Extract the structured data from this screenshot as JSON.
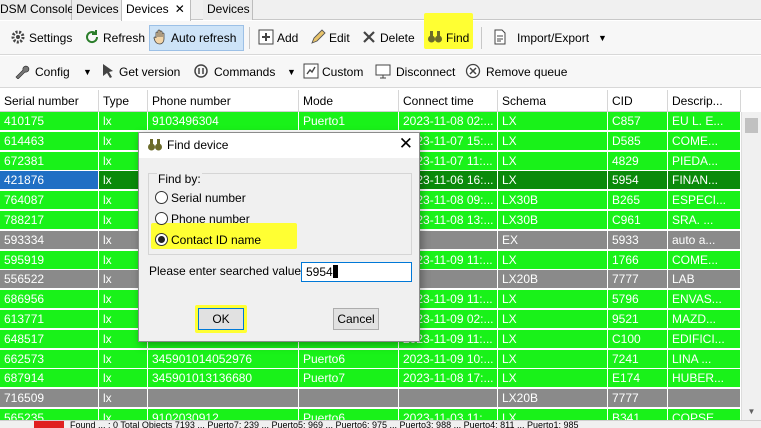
{
  "tabs": [
    {
      "label": "DSM Console",
      "active": false,
      "closable": false
    },
    {
      "label": "Devices",
      "active": false,
      "closable": false
    },
    {
      "label": "Devices",
      "active": true,
      "closable": true
    },
    {
      "label": "Devices",
      "active": false,
      "closable": false
    }
  ],
  "toolbar1": {
    "settings": "Settings",
    "refresh": "Refresh",
    "auto_refresh": "Auto refresh",
    "add": "Add",
    "edit": "Edit",
    "delete": "Delete",
    "find": "Find",
    "import_export": "Import/Export"
  },
  "toolbar2": {
    "config": "Config",
    "get_version": "Get version",
    "commands": "Commands",
    "custom": "Custom",
    "disconnect": "Disconnect",
    "remove_queue": "Remove queue"
  },
  "table": {
    "columns": [
      "Serial number",
      "Type",
      "Phone number",
      "Mode",
      "Connect time",
      "Schema",
      "CID",
      "Descrip..."
    ],
    "rows": [
      {
        "status": "online",
        "cells": [
          "410175",
          "lx",
          "9103496304",
          "Puerto1",
          "2023-11-08 02:...",
          "LX",
          "C857",
          "EU L. E..."
        ]
      },
      {
        "status": "online",
        "cells": [
          "614463",
          "lx",
          "",
          "",
          "2023-11-07 15:...",
          "LX",
          "D585",
          "COME..."
        ]
      },
      {
        "status": "online",
        "cells": [
          "672381",
          "lx",
          "",
          "",
          "2023-11-07 11:...",
          "LX",
          "4829",
          "PIEDA..."
        ]
      },
      {
        "status": "selected",
        "cells": [
          "421876",
          "lx",
          "",
          "",
          "2023-11-06 16:...",
          "LX",
          "5954",
          "FINAN..."
        ]
      },
      {
        "status": "online",
        "cells": [
          "764087",
          "lx",
          "",
          "",
          "2023-11-08 09:...",
          "LX30B",
          "B265",
          "ESPECI..."
        ]
      },
      {
        "status": "online",
        "cells": [
          "788217",
          "lx",
          "",
          "",
          "2023-11-08 13:...",
          "LX30B",
          "C961",
          "SRA. ..."
        ]
      },
      {
        "status": "offline",
        "cells": [
          "593334",
          "lx",
          "",
          "",
          "",
          "EX",
          "5933",
          "auto a..."
        ]
      },
      {
        "status": "online",
        "cells": [
          "595919",
          "lx",
          "",
          "",
          "2023-11-09 11:...",
          "LX",
          "1766",
          "COME..."
        ]
      },
      {
        "status": "offline",
        "cells": [
          "556522",
          "lx",
          "",
          "",
          "",
          "LX20B",
          "7777",
          "LAB"
        ]
      },
      {
        "status": "online",
        "cells": [
          "686956",
          "lx",
          "",
          "",
          "2023-11-09 11:...",
          "LX",
          "5796",
          "ENVAS..."
        ]
      },
      {
        "status": "online",
        "cells": [
          "613771",
          "lx",
          "",
          "",
          "2023-11-09 02:...",
          "LX",
          "9521",
          "MAZD..."
        ]
      },
      {
        "status": "online",
        "cells": [
          "648517",
          "lx",
          "",
          "",
          "2023-11-09 11:...",
          "LX",
          "C100",
          "EDIFICI..."
        ]
      },
      {
        "status": "online",
        "cells": [
          "662573",
          "lx",
          "345901014052976",
          "Puerto6",
          "2023-11-09 10:...",
          "LX",
          "7241",
          "LINA ..."
        ]
      },
      {
        "status": "online",
        "cells": [
          "687914",
          "lx",
          "345901013136680",
          "Puerto7",
          "2023-11-08 17:...",
          "LX",
          "E174",
          "HUBER..."
        ]
      },
      {
        "status": "offline",
        "cells": [
          "716509",
          "lx",
          "",
          "",
          "",
          "LX20B",
          "7777",
          ""
        ]
      },
      {
        "status": "online",
        "cells": [
          "565235",
          "lx",
          "9102030912",
          "Puerto6",
          "2023-11-03 11:...",
          "LX",
          "B341",
          "COPSE..."
        ]
      }
    ]
  },
  "status_bar": {
    "text": "Found ... : 0 Total Objects 7193 ... Puerto7: 239 ... Puerto5: 969 ... Puerto6: 975 ... Puerto3: 988 ... Puerto4: 811 ... Puerto1: 985"
  },
  "dialog": {
    "title": "Find device",
    "find_by": "Find by:",
    "options": [
      "Serial number",
      "Phone number",
      "Contact ID name"
    ],
    "selected_index": 2,
    "value_label": "Please enter searched value:",
    "value": "5954",
    "ok": "OK",
    "cancel": "Cancel"
  },
  "colors": {
    "online": "#19f219",
    "offline": "#8a8a8a",
    "selected_row": "#0a8a0a",
    "selected_cell": "#1f6fc4",
    "highlight": "#ffff33"
  }
}
